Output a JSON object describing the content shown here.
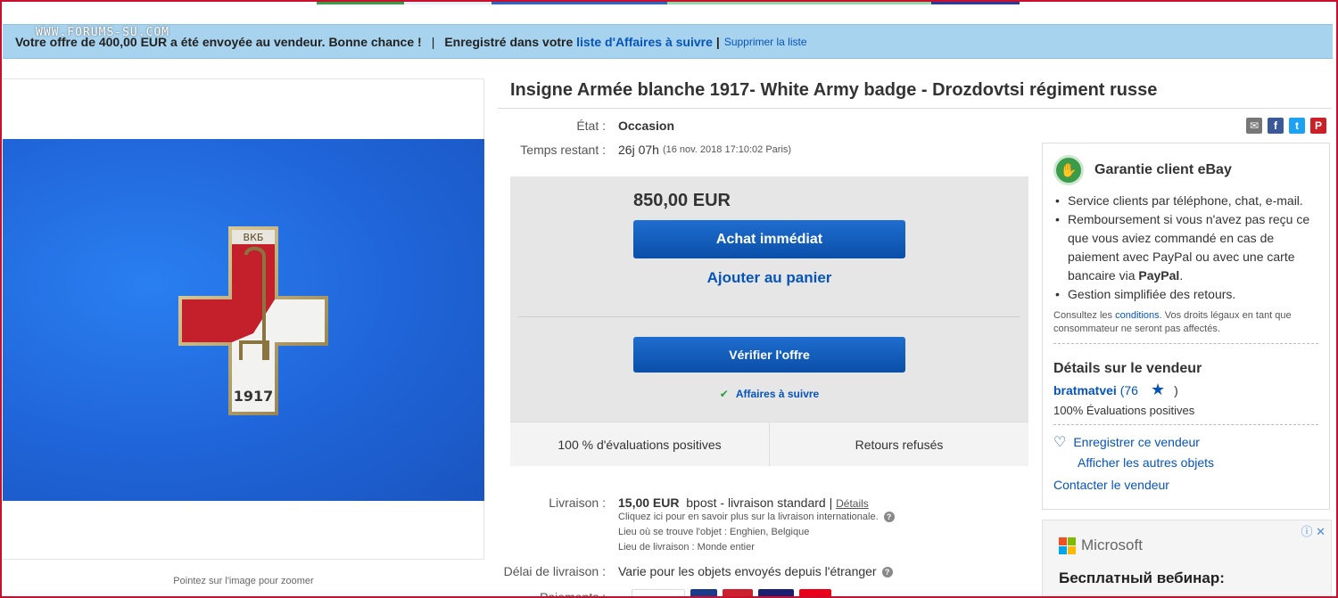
{
  "watermark": "WWW.FORUMS-SU.COM",
  "banner": {
    "offer_text": "Votre offre de 400,00 EUR a été envoyée au vendeur. Bonne chance !",
    "separator": "|",
    "saved_prefix": "Enregistré dans votre",
    "watchlist_link": "liste d'Affaires à suivre",
    "separator2": "|",
    "remove_link": "Supprimer la liste"
  },
  "image": {
    "badge_top_text": "ВКБ",
    "badge_year": "1917",
    "zoom_hint": "Pointez sur l'image pour zoomer"
  },
  "item": {
    "title": "Insigne Armée blanche 1917- White Army badge - Drozdovtsi régiment russe",
    "condition_label": "État :",
    "condition_value": "Occasion",
    "time_label": "Temps restant :",
    "time_value": "26j 07h",
    "time_detail": "(16 nov. 2018   17:10:02 Paris)"
  },
  "buybox": {
    "price": "850,00 EUR",
    "buy_now": "Achat immédiat",
    "add_to_cart": "Ajouter au panier",
    "review_offer": "Vérifier l'offre",
    "watch": "Affaires à suivre",
    "positive": "100 % d'évaluations positives",
    "returns": "Retours refusés"
  },
  "shipping": {
    "label": "Livraison :",
    "price": "15,00 EUR",
    "method": "bpost - livraison standard |",
    "details_link": "Détails",
    "intl_note": "Cliquez ici pour en savoir plus sur la livraison internationale.",
    "location": "Lieu où se trouve l'objet :  Enghien, Belgique",
    "ships_to": "Lieu de livraison :  Monde entier",
    "delay_label": "Délai de livraison :",
    "delay_value": "Varie pour les objets envoyés depuis l'étranger",
    "payment_label": "Paiements :"
  },
  "guarantee": {
    "title": "Garantie client eBay",
    "items": [
      "Service clients par téléphone, chat, e-mail.",
      "Remboursement si vous n'avez pas reçu ce que vous aviez commandé en cas de paiement avec PayPal ou avec une carte bancaire via",
      "Gestion simplifiée des retours."
    ],
    "paypal_bold": "PayPal",
    "paypal_end": ".",
    "note_prefix": "Consultez les",
    "note_link": "conditions",
    "note_suffix": ". Vos droits légaux en tant que consommateur ne seront pas affectés."
  },
  "seller": {
    "heading": "Détails sur le vendeur",
    "name": "bratmatvei",
    "score_open": "(76",
    "score_close": ")",
    "positive": "100% Évaluations positives",
    "save": "Enregistrer ce vendeur",
    "other_items": "Afficher les autres objets",
    "contact": "Contacter le vendeur"
  },
  "ad": {
    "brand": "Microsoft",
    "text": "Бесплатный вебинар:"
  },
  "colors": {
    "link": "#0654ba",
    "banner_bg": "#a7d3ef",
    "button": "#0a4fa8",
    "buybox_bg": "#e6e6e6"
  },
  "icons": [
    "email-icon",
    "facebook-icon",
    "twitter-icon",
    "pinterest-icon",
    "check-icon",
    "star-icon",
    "heart-icon",
    "help-icon",
    "adchoices-icon"
  ]
}
